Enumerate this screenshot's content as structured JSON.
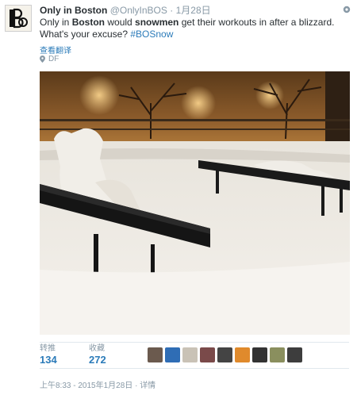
{
  "tweet": {
    "name": "Only in Boston",
    "handle": "@OnlyInBOS",
    "separator": "·",
    "date": "1月28日",
    "text_parts": [
      "Only in ",
      "Boston",
      " would ",
      "snowmen",
      " get their workouts in after a blizzard. What's your excuse? "
    ],
    "hashtag": "#BOSnow",
    "translate_label": "查看翻译",
    "place": "DF",
    "avatar_letters": "BO",
    "icons": {
      "settings": "gear-icon",
      "place": "location-pin-icon"
    }
  },
  "stats": {
    "retweets_label": "转推",
    "retweets_value": "134",
    "favorites_label": "收藏",
    "favorites_value": "272",
    "faver_avatars": [
      "#6b5a4e",
      "#2f6db5",
      "#c9c2b6",
      "#7a4a4a",
      "#444444",
      "#e08a2c",
      "#333333",
      "#8a8f5e",
      "#3d3d3d"
    ]
  },
  "footer": {
    "timestamp": "上午8:33 - 2015年1月28日",
    "separator": "·",
    "details_label": "详情"
  },
  "colors": {
    "link": "#2b7bb9",
    "muted": "#8899a6",
    "text": "#292f33"
  }
}
